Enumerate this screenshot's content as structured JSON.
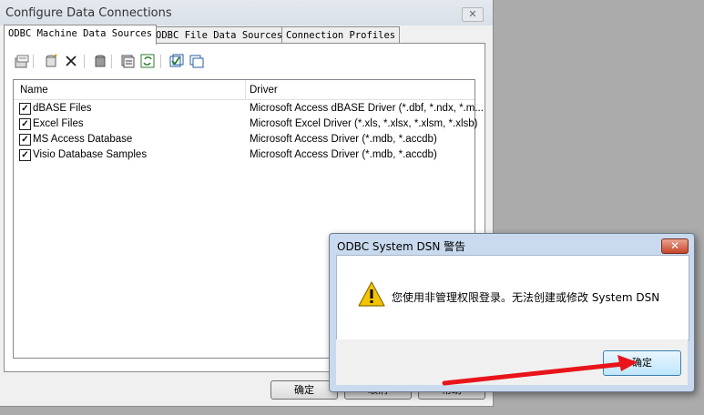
{
  "main_window": {
    "title": "Configure Data Connections",
    "close_glyph": "✕"
  },
  "tabs": [
    {
      "label": "ODBC Machine Data Sources",
      "active": true
    },
    {
      "label": "ODBC File Data Sources",
      "active": false
    },
    {
      "label": "Connection Profiles",
      "active": false
    }
  ],
  "toolbar": {
    "icons": [
      "properties-icon",
      "new-icon",
      "delete-icon",
      "database-icon",
      "test-connection-icon",
      "refresh-icon",
      "select-all-icon",
      "window-icon"
    ]
  },
  "list": {
    "columns": [
      "Name",
      "Driver"
    ],
    "rows": [
      {
        "name": "dBASE Files",
        "driver": "Microsoft Access dBASE Driver (*.dbf, *.ndx, *.m...",
        "checked": true
      },
      {
        "name": "Excel Files",
        "driver": "Microsoft Excel Driver (*.xls, *.xlsx, *.xlsm, *.xlsb)",
        "checked": true
      },
      {
        "name": "MS Access Database",
        "driver": "Microsoft Access Driver (*.mdb, *.accdb)",
        "checked": true
      },
      {
        "name": "Visio Database Samples",
        "driver": "Microsoft Access Driver (*.mdb, *.accdb)",
        "checked": true
      }
    ]
  },
  "bottom_buttons": [
    "确定",
    "取消",
    "帮助"
  ],
  "dialog": {
    "title": "ODBC System DSN 警告",
    "close_glyph": "✕",
    "message": "您使用非管理权限登录。无法创建或修改 System DSN",
    "ok_label": "确定"
  },
  "colors": {
    "arrow": "#e8141a",
    "dialog_frame": "#c9daef"
  }
}
